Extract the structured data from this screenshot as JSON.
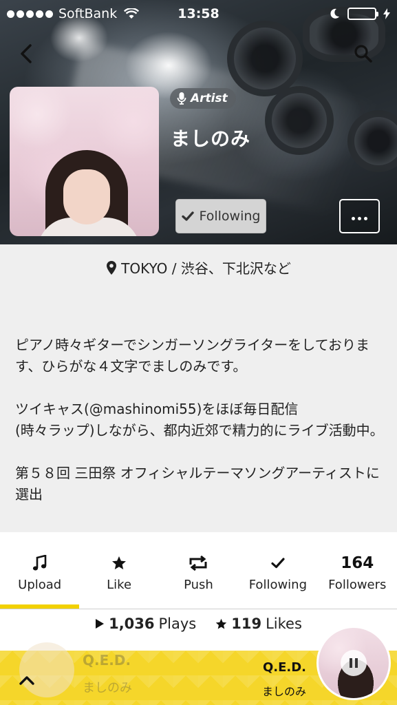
{
  "status_bar": {
    "carrier": "SoftBank",
    "time": "13:58",
    "battery_color": "#4cd964"
  },
  "header": {
    "badge_label": "Artist",
    "artist_name": "ましのみ",
    "following_label": "Following",
    "back_icon": "chevron-left-icon",
    "search_icon": "search-icon",
    "more_icon": "ellipsis-icon"
  },
  "profile": {
    "location": "TOKYO / 渋谷、下北沢など",
    "bio": "ピアノ時々ギターでシンガーソングライターをしております、ひらがな４文字でましのみです。\n\nツイキャス(@mashinomi55)をほぼ毎日配信\n(時々ラップ)しながら、都内近郊で精力的にライブ活動中。\n\n第５８回 三田祭 オフィシャルテーマソングアーティストに選出"
  },
  "stats": [
    {
      "label": "Upload",
      "icon": "music-note-icon",
      "active": true
    },
    {
      "label": "Like",
      "icon": "star-icon"
    },
    {
      "label": "Push",
      "icon": "repost-icon"
    },
    {
      "label": "Following",
      "icon": "check-icon"
    },
    {
      "label": "Followers",
      "count": "164"
    }
  ],
  "plays_bar": {
    "plays_count": "1,036",
    "plays_label": "Plays",
    "likes_count": "119",
    "likes_label": "Likes"
  },
  "player": {
    "title": "Q.E.D.",
    "artist": "ましのみ",
    "accent_color": "#f5d62a"
  }
}
